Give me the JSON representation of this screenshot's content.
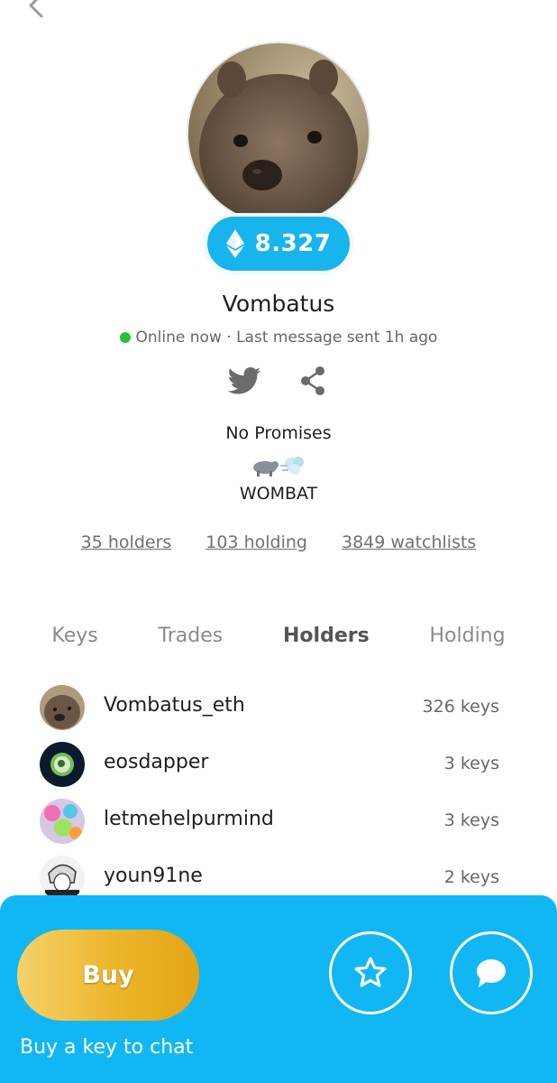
{
  "profile": {
    "price": "8.327",
    "name": "Vombatus",
    "status_online": "Online now",
    "status_last": "Last message sent 1h ago",
    "bio_line1": "No Promises",
    "bio_line2": "WOMBAT"
  },
  "stats": {
    "holders": "35 holders",
    "holding": "103 holding",
    "watchlists": "3849 watchlists"
  },
  "tabs": [
    {
      "label": "Keys",
      "active": false
    },
    {
      "label": "Trades",
      "active": false
    },
    {
      "label": "Holders",
      "active": true
    },
    {
      "label": "Holding",
      "active": false
    }
  ],
  "holders": [
    {
      "name": "Vombatus_eth",
      "keys": "326 keys"
    },
    {
      "name": "eosdapper",
      "keys": "3 keys"
    },
    {
      "name": "letmehelpurmind",
      "keys": "3 keys"
    },
    {
      "name": "youn91ne",
      "keys": "2 keys"
    }
  ],
  "actions": {
    "buy_label": "Buy",
    "buy_hint": "Buy a key to chat"
  },
  "icons": {
    "back": "chevron-left-icon",
    "currency": "ethereum-icon",
    "twitter": "twitter-icon",
    "share": "share-icon",
    "star": "star-icon",
    "chat": "chat-bubble-icon"
  },
  "colors": {
    "accent": "#11b7f2",
    "online": "#27c03a",
    "buy_start": "#f5d26a",
    "buy_end": "#e4a418"
  }
}
